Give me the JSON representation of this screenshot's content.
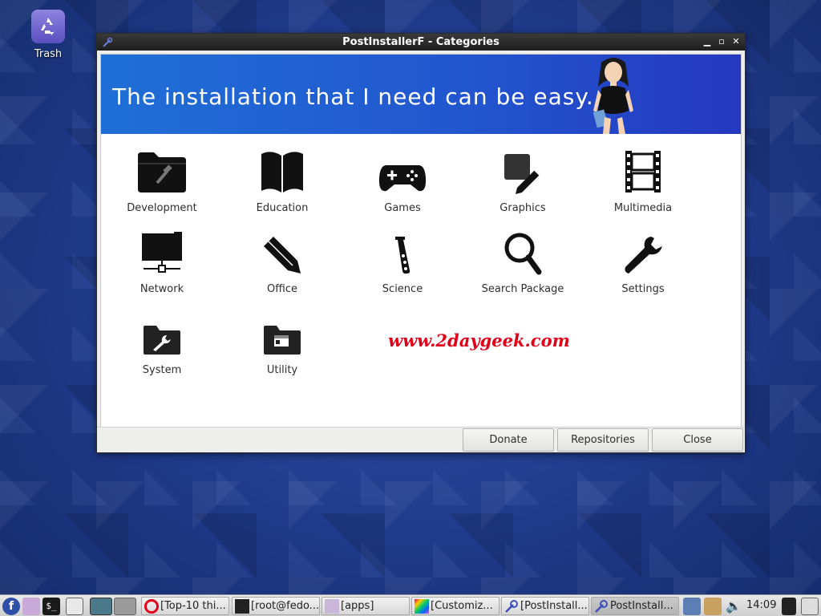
{
  "desktop": {
    "trash_label": "Trash"
  },
  "window": {
    "title": "PostInstallerF - Categories",
    "banner_text": "The installation that I need can be easy...",
    "watermark": "www.2daygeek.com",
    "categories": [
      {
        "label": "Development",
        "icon": "folder-hammer-icon"
      },
      {
        "label": "Education",
        "icon": "book-icon"
      },
      {
        "label": "Games",
        "icon": "gamepad-icon"
      },
      {
        "label": "Graphics",
        "icon": "graphics-pencil-icon"
      },
      {
        "label": "Multimedia",
        "icon": "film-strip-icon"
      },
      {
        "label": "Network",
        "icon": "network-icon"
      },
      {
        "label": "Office",
        "icon": "pencil-icon"
      },
      {
        "label": "Science",
        "icon": "test-tube-icon"
      },
      {
        "label": "Search Package",
        "icon": "magnifier-icon"
      },
      {
        "label": "Settings",
        "icon": "wrench-icon"
      },
      {
        "label": "System",
        "icon": "folder-wrench-icon"
      },
      {
        "label": "Utility",
        "icon": "folder-window-icon"
      }
    ],
    "buttons": {
      "donate": "Donate",
      "repositories": "Repositories",
      "close": "Close"
    }
  },
  "taskbar": {
    "tasks": [
      {
        "label": "[Top-10 thi...",
        "icon": "opera-icon",
        "color": "#e0001a"
      },
      {
        "label": "[root@fedo...",
        "icon": "terminal-icon",
        "color": "#222222"
      },
      {
        "label": "[apps]",
        "icon": "folder-icon",
        "color": "#c9b6d8"
      },
      {
        "label": "[Customiz...",
        "icon": "color-picker-icon",
        "color": "#c05ad0"
      },
      {
        "label": "[PostInstall...",
        "icon": "postinstaller-icon",
        "color": "#3b4fbf"
      },
      {
        "label": "PostInstall...",
        "icon": "postinstaller-icon",
        "color": "#3b4fbf"
      }
    ],
    "clock": "14:09"
  }
}
